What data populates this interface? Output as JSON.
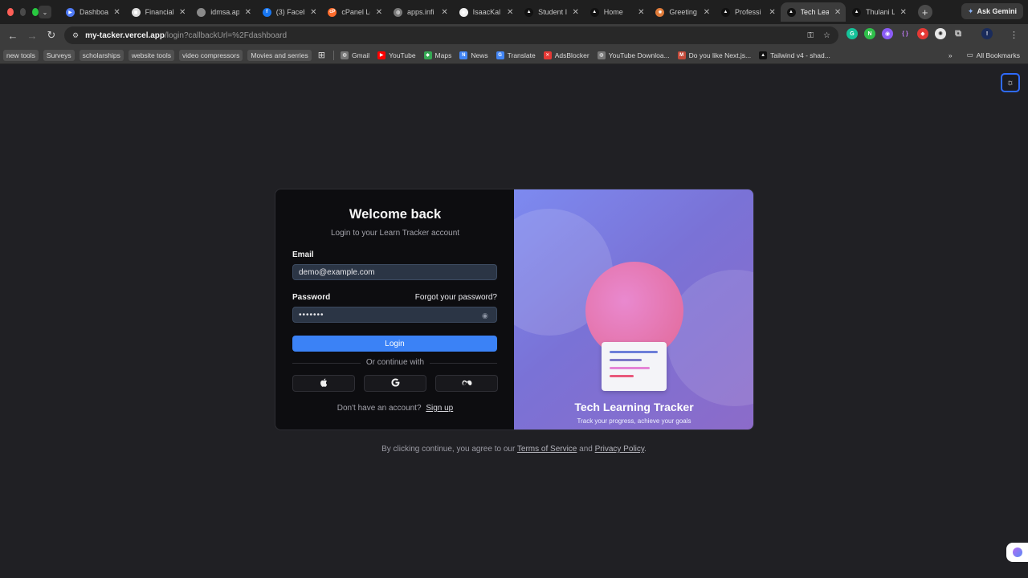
{
  "browser": {
    "tabs": [
      {
        "label": "Dashboa",
        "fav": "▶",
        "color": "#4f7bf7"
      },
      {
        "label": "Financial",
        "fav": "◼",
        "color": "#dddddd"
      },
      {
        "label": "idmsa.ap",
        "fav": "",
        "color": "#8a8a8a"
      },
      {
        "label": "(3) Faceb",
        "fav": "f",
        "color": "#1877f2"
      },
      {
        "label": "cPanel Lo",
        "fav": "cP",
        "color": "#ff6c2c"
      },
      {
        "label": "apps.infi",
        "fav": "◍",
        "color": "#7a7a7a"
      },
      {
        "label": "IsaacKal",
        "fav": "◉",
        "color": "#f0f0f0"
      },
      {
        "label": "Student I",
        "fav": "▲",
        "color": "#111111"
      },
      {
        "label": "Home",
        "fav": "▲",
        "color": "#111111"
      },
      {
        "label": "Greeting",
        "fav": "✺",
        "color": "#e07b39"
      },
      {
        "label": "Professi",
        "fav": "▲",
        "color": "#111111"
      },
      {
        "label": "Tech Lea",
        "fav": "▲",
        "color": "#111111",
        "active": true
      },
      {
        "label": "Thulani L",
        "fav": "▲",
        "color": "#111111"
      }
    ],
    "ask_gemini": "Ask Gemini",
    "url_host": "my-tacker.vercel.app",
    "url_path": "/login?callbackUrl=%2Fdashboard",
    "bookmark_chips": [
      "new tools",
      "Surveys",
      "scholarships",
      "website tools",
      "video compressors",
      "Movies and serries"
    ],
    "bookmarks": [
      {
        "label": "Gmail",
        "fav": "◍",
        "color": "#777777"
      },
      {
        "label": "YouTube",
        "fav": "▶",
        "color": "#ff0000"
      },
      {
        "label": "Maps",
        "fav": "◆",
        "color": "#34a853"
      },
      {
        "label": "News",
        "fav": "N",
        "color": "#4285f4"
      },
      {
        "label": "Translate",
        "fav": "G",
        "color": "#4285f4"
      },
      {
        "label": "AdsBlocker",
        "fav": "✕",
        "color": "#e53935"
      },
      {
        "label": "YouTube Downloa...",
        "fav": "◍",
        "color": "#777777"
      },
      {
        "label": "Do you like Next.js...",
        "fav": "M",
        "color": "#c44a3a"
      },
      {
        "label": "Tailwind v4 - shad...",
        "fav": "▲",
        "color": "#111111"
      }
    ],
    "all_bookmarks": "All Bookmarks"
  },
  "login": {
    "title": "Welcome back",
    "subtitle": "Login to your Learn Tracker account",
    "email_label": "Email",
    "email_value": "demo@example.com",
    "password_label": "Password",
    "forgot": "Forgot your password?",
    "password_value": "•••••••",
    "login_button": "Login",
    "or_continue": "Or continue with",
    "no_account": "Don't have an account?",
    "sign_up": "Sign up"
  },
  "promo": {
    "title": "Tech Learning Tracker",
    "subtitle": "Track your progress, achieve your goals"
  },
  "terms": {
    "prefix": "By clicking continue, you agree to our",
    "tos": "Terms of Service",
    "and": "and",
    "privacy": "Privacy Policy",
    "suffix": "."
  }
}
